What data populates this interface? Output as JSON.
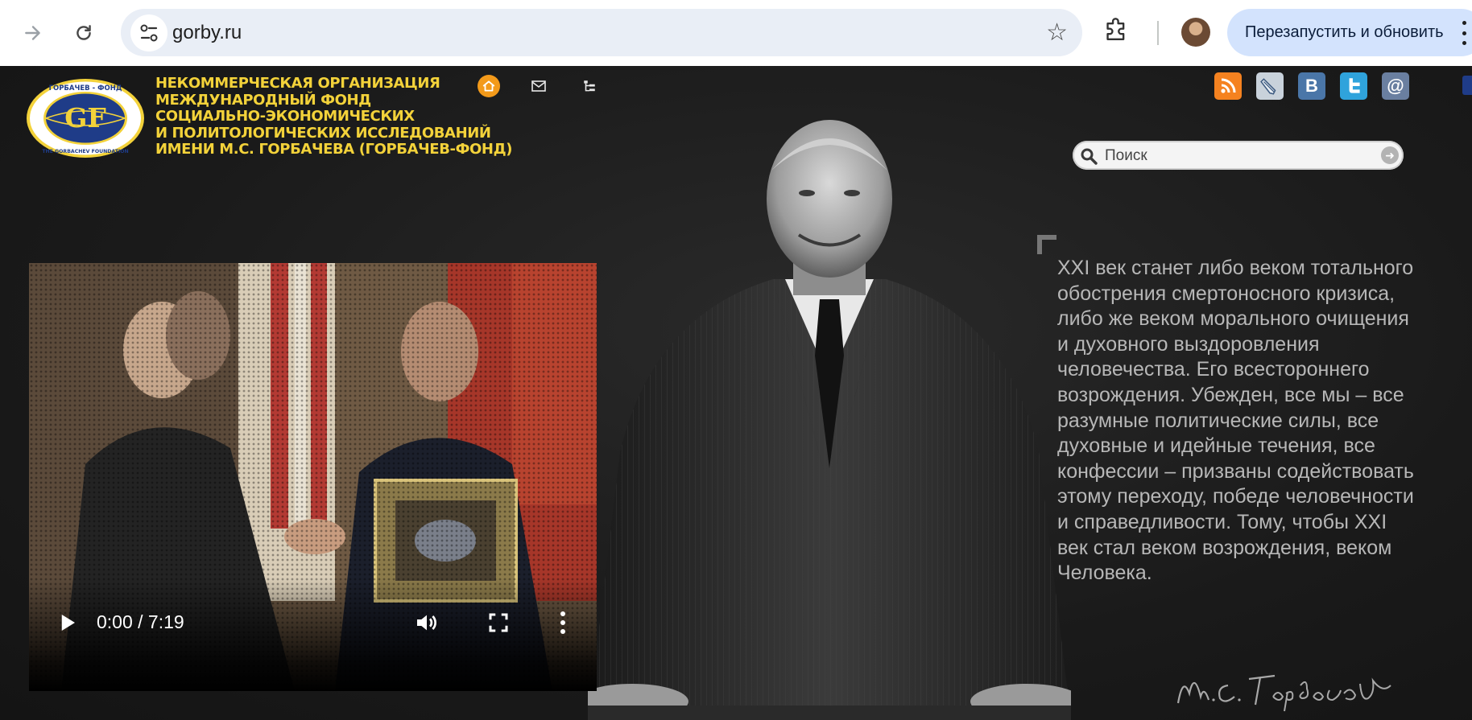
{
  "browser": {
    "url": "gorby.ru",
    "relaunch_label": "Перезапустить и обновить",
    "icons": [
      "forward-icon",
      "reload-icon",
      "site-info-icon",
      "star-icon",
      "extensions-icon",
      "profile-avatar",
      "menu-kebab-icon"
    ]
  },
  "header": {
    "logo_text_top": "ГОРБАЧЕВ - ФОНД",
    "logo_initials": "GF",
    "logo_text_bottom": "THE GORBACHEV FOUNDATION",
    "org_lines": [
      "НЕКОММЕРЧЕСКАЯ ОРГАНИЗАЦИЯ",
      "МЕЖДУНАРОДНЫЙ ФОНД",
      "СОЦИАЛЬНО-ЭКОНОМИЧЕСКИХ",
      "И ПОЛИТОЛОГИЧЕСКИХ ИССЛЕДОВАНИЙ",
      "ИМЕНИ М.С. ГОРБАЧЕВА (ГОРБАЧЕВ-ФОНД)"
    ],
    "quick_icons": [
      "home-icon",
      "mail-icon",
      "sitemap-icon"
    ],
    "social": [
      {
        "name": "rss",
        "color": "#f58220"
      },
      {
        "name": "livejournal",
        "color": "#c9d2db"
      },
      {
        "name": "vkontakte",
        "color": "#4a76a8",
        "label": "B"
      },
      {
        "name": "twitter",
        "color": "#2fa3dc"
      },
      {
        "name": "email",
        "color": "#6a7fa0",
        "label": "@"
      }
    ]
  },
  "search": {
    "placeholder": "Поиск"
  },
  "video": {
    "time": "0:00 / 7:19",
    "progress": 0.03
  },
  "quote": {
    "text": "XXI век станет либо веком тотального обострения смертоносного кризиса, либо же веком морального очищения и духовного выздоровления человечества. Его всестороннего возрождения. Убежден, все мы – все разумные политические силы, все духовные и идейные течения, все конфессии – призваны содействовать этому переходу, победе человечности и справедливости. Тому, чтобы XXI век стал веком возрождения, веком Человека.",
    "signature": "М.С. Горбачев"
  },
  "colors": {
    "accent_yellow": "#f3d23a",
    "page_background": "#1c1c1c",
    "home_icon": "#f39a1a",
    "relaunch_button": "#d3e3fd"
  }
}
